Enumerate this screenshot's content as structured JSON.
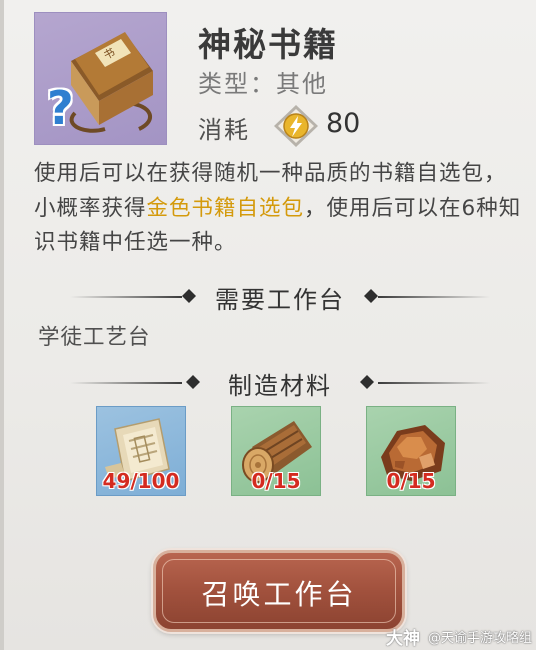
{
  "item": {
    "name": "神秘书籍",
    "type_text": "类型：其他",
    "cost_label": "消耗",
    "cost_value": "80",
    "icon": "mystery-book-icon",
    "question_mark": "?",
    "book_label": "书"
  },
  "description": {
    "part1": "使用后可以在获得随机一种品质的书籍自选包，小概率获得",
    "highlight": "金色书籍自选包",
    "part2": "，使用后可以在6种知识书籍中任选一种。"
  },
  "workbench_section": {
    "header": "需要工作台",
    "bench_name": "学徒工艺台"
  },
  "materials_section": {
    "header": "制造材料",
    "items": [
      {
        "icon": "blueprint-scroll-icon",
        "count": "49/100",
        "rarity": "blue"
      },
      {
        "icon": "wood-log-icon",
        "count": "0/15",
        "rarity": "green"
      },
      {
        "icon": "copper-ore-icon",
        "count": "0/15",
        "rarity": "green"
      }
    ]
  },
  "actions": {
    "summon_button": "召唤工作台"
  },
  "watermark": {
    "logo": "大神",
    "text": "@天谕手游攻略组"
  },
  "colors": {
    "highlight": "#d49a0c",
    "count_red": "#d42b20",
    "button": "#a1513d",
    "rarity_purple": "#a394c4",
    "rarity_blue": "#7eaed6",
    "rarity_green": "#8cc195"
  }
}
